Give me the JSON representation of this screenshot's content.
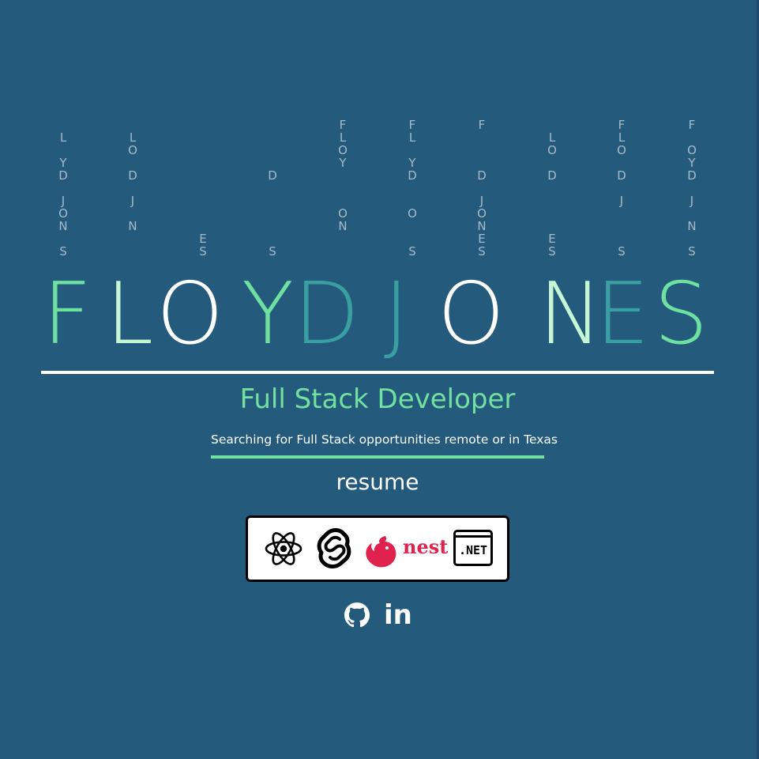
{
  "background_color": "#245a7c",
  "rain_columns": [
    {
      "letters": [
        "L",
        "Y",
        "D",
        "J",
        "O",
        "N",
        "S"
      ]
    },
    {
      "letters": [
        "L",
        "O",
        "D",
        "J",
        "N"
      ]
    },
    {
      "letters": [
        "E",
        "S"
      ]
    },
    {
      "letters": [
        "D",
        "S"
      ]
    },
    {
      "letters": [
        "F",
        "L",
        "O",
        "Y",
        "O",
        "N"
      ]
    },
    {
      "letters": [
        "F",
        "L",
        "Y",
        "D",
        "O",
        "S"
      ]
    },
    {
      "letters": [
        "F",
        "D",
        "J",
        "O",
        "N",
        "E",
        "S"
      ]
    },
    {
      "letters": [
        "L",
        "O",
        "D",
        "E",
        "S"
      ]
    },
    {
      "letters": [
        "F",
        "L",
        "O",
        "D",
        "J",
        "S"
      ]
    },
    {
      "letters": [
        "F",
        "O",
        "Y",
        "D",
        "J",
        "N",
        "S"
      ]
    }
  ],
  "name": {
    "letters": [
      "F",
      "L",
      "O",
      "Y",
      "D",
      "J",
      "O",
      "N",
      "E",
      "S"
    ],
    "colors": [
      "#6fe0a0",
      "#c6f7d4",
      "#ffffff",
      "#6fe0a0",
      "#3a9fa0",
      "#3a9fa0",
      "#ffffff",
      "#c6f7d4",
      "#3a9fa0",
      "#6fe0a0"
    ]
  },
  "subtitle": "Full Stack Developer",
  "tagline": "Searching for Full Stack opportunities remote or in Texas",
  "resume_label": "resume",
  "tech_stack": {
    "icons": [
      "react-icon",
      "svelte-icon",
      "nestjs-icon",
      "dotnet-icon"
    ],
    "nest_label": "nest",
    "dotnet_label": ".NET"
  },
  "social": {
    "icons": [
      "github-icon",
      "linkedin-icon"
    ],
    "linkedin_label": "in"
  },
  "accent_color": "#72e0a0",
  "nest_color": "#e0234e"
}
